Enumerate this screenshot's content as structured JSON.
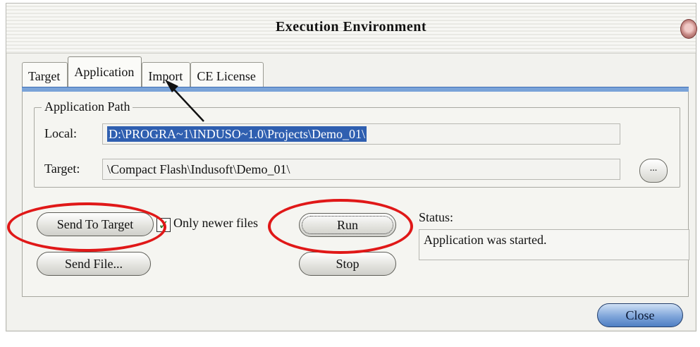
{
  "window": {
    "title": "Execution Environment",
    "close_icon": "close-orb-icon"
  },
  "tabs": [
    {
      "label": "Target"
    },
    {
      "label": "Application",
      "active": true
    },
    {
      "label": "Import"
    },
    {
      "label": "CE License"
    }
  ],
  "app_path": {
    "group_label": "Application Path",
    "local_label": "Local:",
    "local_value": "D:\\PROGRA~1\\INDUSO~1.0\\Projects\\Demo_01\\",
    "target_label": "Target:",
    "target_value": "\\Compact Flash\\Indusoft\\Demo_01\\",
    "browse_label": "..."
  },
  "actions": {
    "send_to_target": "Send To Target",
    "only_newer_files": "Only newer files",
    "only_newer_checked": true,
    "send_file": "Send File...",
    "run": "Run",
    "stop": "Stop"
  },
  "status": {
    "label": "Status:",
    "text": "Application was started."
  },
  "footer": {
    "close_label": "Close"
  },
  "colors": {
    "highlight_red": "#e01818",
    "tab_strip_blue": "#7aa3d8",
    "selection_blue": "#2f5fb0"
  }
}
